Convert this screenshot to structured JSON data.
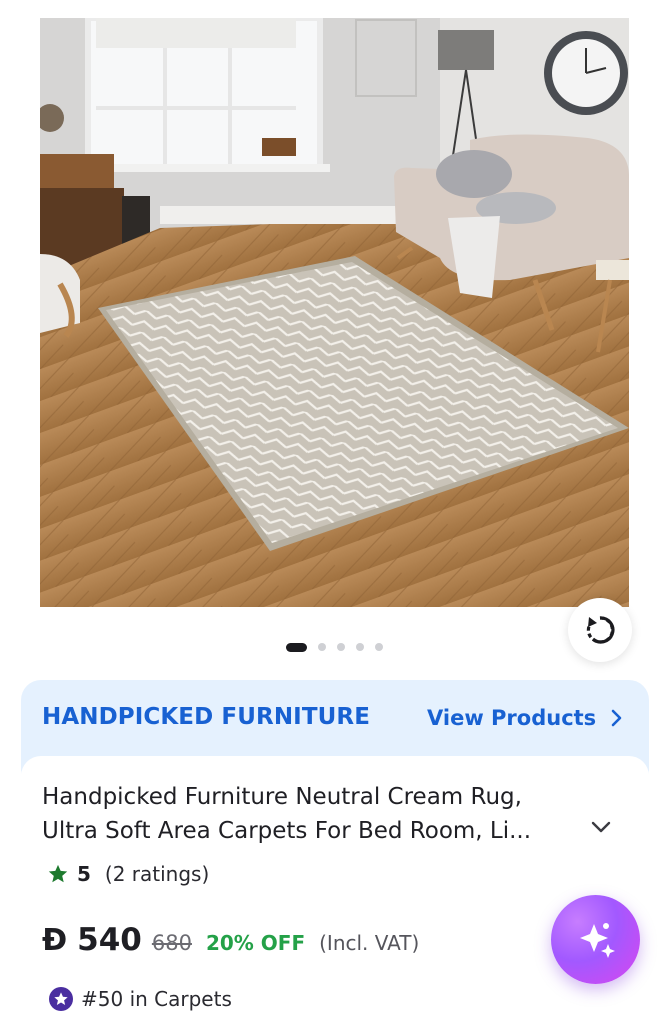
{
  "product_image": {
    "alt_subject": "rug-photo"
  },
  "carousel": {
    "total": 5,
    "active_index": 0
  },
  "brand": {
    "name": "HANDPICKED FURNITURE",
    "link_label": "View Products",
    "accent_color": "#1861d2"
  },
  "product": {
    "title_line1": "Handpicked Furniture Neutral Cream Rug,",
    "title_line2": "Ultra Soft Area Carpets For Bed Room, Li...",
    "rating": "5",
    "ratings_count": "(2 ratings)",
    "currency_symbol": "Đ",
    "price": "540",
    "old_price": "680",
    "discount": "20% OFF",
    "vat_note": "(Incl. VAT)",
    "rank": "#50 in Carpets"
  },
  "colors": {
    "rating_star": "#1d7a2e",
    "discount": "#24a148",
    "rank_badge": "#4a2ea0"
  },
  "icons": {
    "rotate": "rotate-360-icon",
    "chevron_right": "chevron-right-icon",
    "chevron_down": "chevron-down-icon",
    "star": "star-icon",
    "rank": "star-badge-icon",
    "assistant": "sparkle-assistant-icon"
  }
}
